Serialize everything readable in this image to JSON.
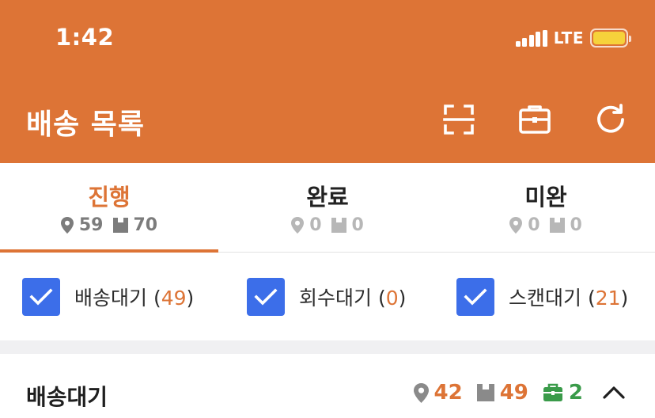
{
  "status_bar": {
    "time": "1:42",
    "network": "LTE",
    "battery_color": "#f6d23b"
  },
  "header": {
    "title": "배송 목록",
    "background_color": "#dd7436",
    "actions": [
      "scan-icon",
      "briefcase-icon",
      "refresh-icon"
    ]
  },
  "tabs": [
    {
      "label": "진행",
      "locations": "59",
      "packages": "70",
      "active": true
    },
    {
      "label": "완료",
      "locations": "0",
      "packages": "0",
      "active": false
    },
    {
      "label": "미완",
      "locations": "0",
      "packages": "0",
      "active": false
    }
  ],
  "filters": [
    {
      "label": "배송대기",
      "open": " (",
      "count": "49",
      "close": ")",
      "checked": true
    },
    {
      "label": "회수대기",
      "open": " (",
      "count": "0",
      "close": ")",
      "checked": true
    },
    {
      "label": "스캔대기",
      "open": " (",
      "count": "21",
      "close": ")",
      "checked": true
    }
  ],
  "section": {
    "title": "배송대기",
    "locations": "42",
    "packages": "49",
    "pickups": "2",
    "expanded": true
  },
  "colors": {
    "accent": "#dd7436",
    "checkbox": "#3c6ee9",
    "success": "#3a9b4a"
  }
}
